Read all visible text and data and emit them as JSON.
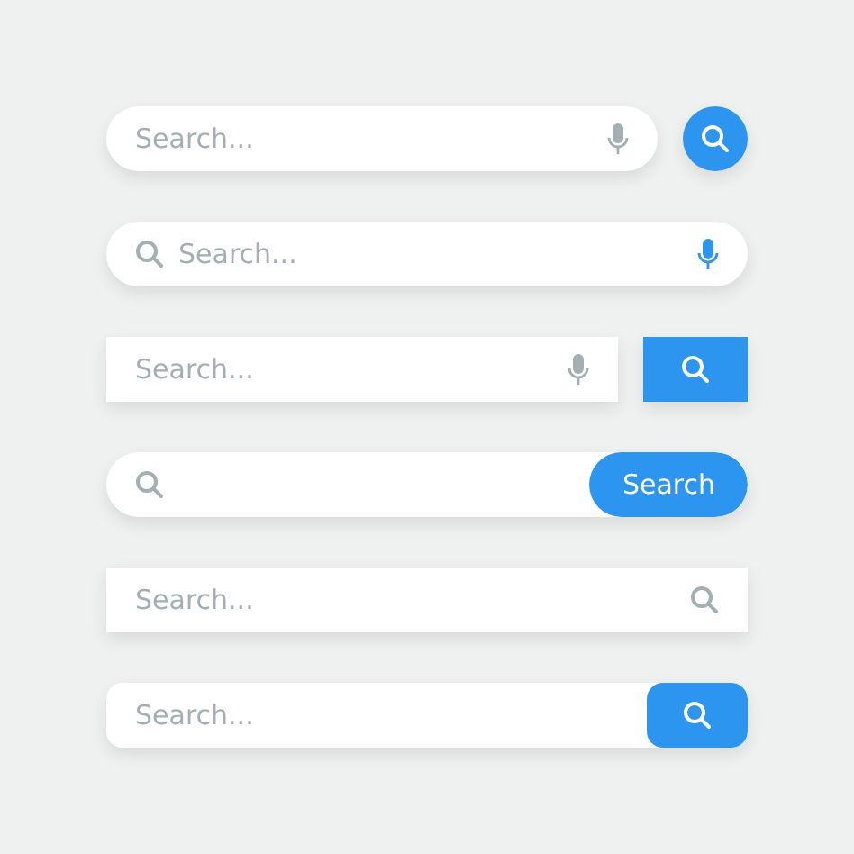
{
  "search_bars": [
    {
      "kind": "capsule",
      "placeholder": "Search..."
    },
    {
      "kind": "voice",
      "placeholder": "Search..."
    },
    {
      "kind": "block",
      "placeholder": "Search..."
    },
    {
      "kind": "labeled",
      "button_label": "Search"
    },
    {
      "kind": "plain",
      "placeholder": "Search..."
    },
    {
      "kind": "tabbed",
      "placeholder": "Search..."
    }
  ]
}
